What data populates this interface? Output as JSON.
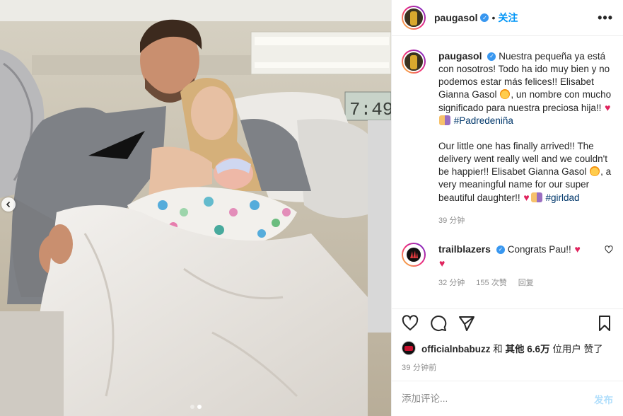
{
  "header": {
    "username": "paugasol",
    "separator": "•",
    "follow_label": "关注",
    "more_label": "•••"
  },
  "caption": {
    "username": "paugasol",
    "text_es_1": "Nuestra pequeña ya está con nosotros! Todo ha ido muy bien y no podemos estar más felices!! Elisabet Gianna Gasol",
    "text_es_2": ", un nombre con mucho significado para nuestra preciosa hija!!",
    "hashtag_es": "#Padredeniña",
    "text_en_1": "Our little one has finally arrived!! The delivery went really well and we couldn't be happier!! Elisabet Gianna Gasol",
    "text_en_2": ", a very meaningful name for our super beautiful daughter!!",
    "hashtag_en": "#girldad",
    "time": "39 分钟"
  },
  "comment": {
    "username": "trailblazers",
    "text": "Congrats Pau!!",
    "time": "32 分钟",
    "likes": "155 次赞",
    "reply": "回复"
  },
  "likes": {
    "user": "officialnbabuzz",
    "connector": "和",
    "others_prefix": "其他",
    "count": "6.6万",
    "suffix": "位用户 赞了"
  },
  "post_time": "39 分钟前",
  "add_comment": {
    "placeholder": "添加评论...",
    "post_label": "发布"
  },
  "carousel": {
    "total": 2,
    "active_index": 0
  },
  "colors": {
    "accent": "#0095f6",
    "verified": "#3897f0",
    "heart": "#e0245e",
    "hashtag": "#00376b",
    "muted": "#8e8e8e"
  }
}
